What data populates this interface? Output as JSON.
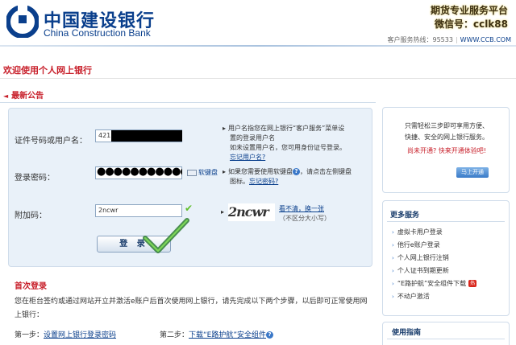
{
  "header": {
    "bank_name_cn": "中国建设银行",
    "bank_name_en": "China Construction Bank",
    "promo_line1": "期货专业服务平台",
    "promo_line2": "微信号：cclk88",
    "hotline_label": "客户服务热线：95533",
    "site_url": "WWW.CCB.COM"
  },
  "page": {
    "welcome": "欢迎使用个人网上银行",
    "announcement": "最新公告"
  },
  "login": {
    "id_label": "证件号码或用户名：",
    "id_value": "421",
    "id_hint_line1": "用户名指您在网上银行“客户服务”菜单设",
    "id_hint_line2": "置的登录用户名",
    "id_hint_line3": "如未设置用户名，您可用身份证号登录。",
    "id_hint_link": "忘记用户名?",
    "pwd_label": "登录密码：",
    "pwd_value": "●●●●●●●●●●●",
    "soft_keyboard": "软键盘",
    "pwd_hint_line1": "如果您需要使用软键盘",
    "pwd_hint_line1b": "，请点击左侧键盘",
    "pwd_hint_line2": "图标。",
    "pwd_hint_link": "忘记密码?",
    "extra_label": "附加码：",
    "extra_value": "2ncwr",
    "captcha_text": "2ncwr",
    "captcha_refresh": "看不清，换一张",
    "captcha_note": "（不区分大小写）",
    "login_button": "登 录"
  },
  "first_login": {
    "title": "首次登录",
    "text": "您在柜台签约或通过网站开立并激活e账户后首次使用网上银行，请先完成以下两个步骤，以后即可正常使用网上银行：",
    "step1_label": "第一步：",
    "step1_link": "设置网上银行登录密码",
    "step2_label": "第二步：",
    "step2_link": "下载“E路护航”安全组件"
  },
  "sidebar": {
    "intro_line1": "只需轻松三步即可享用方便、",
    "intro_line2": "快捷、安全的网上银行服务。",
    "not_open": "尚未开通? 快来开通体验吧!",
    "open_button": "马上开通",
    "more_title": "更多服务",
    "services": [
      "虚拟卡用户登录",
      "他行e账户登录",
      "个人网上银行注销",
      "个人证书到期更新",
      "“E路护航”安全组件下载",
      "不动户激活"
    ],
    "new_badge": "热",
    "guide_title": "使用指南"
  },
  "colors": {
    "brand_blue": "#0a3f8c",
    "accent_red": "#c8202b",
    "panel_bg": "#e9f1f9"
  }
}
